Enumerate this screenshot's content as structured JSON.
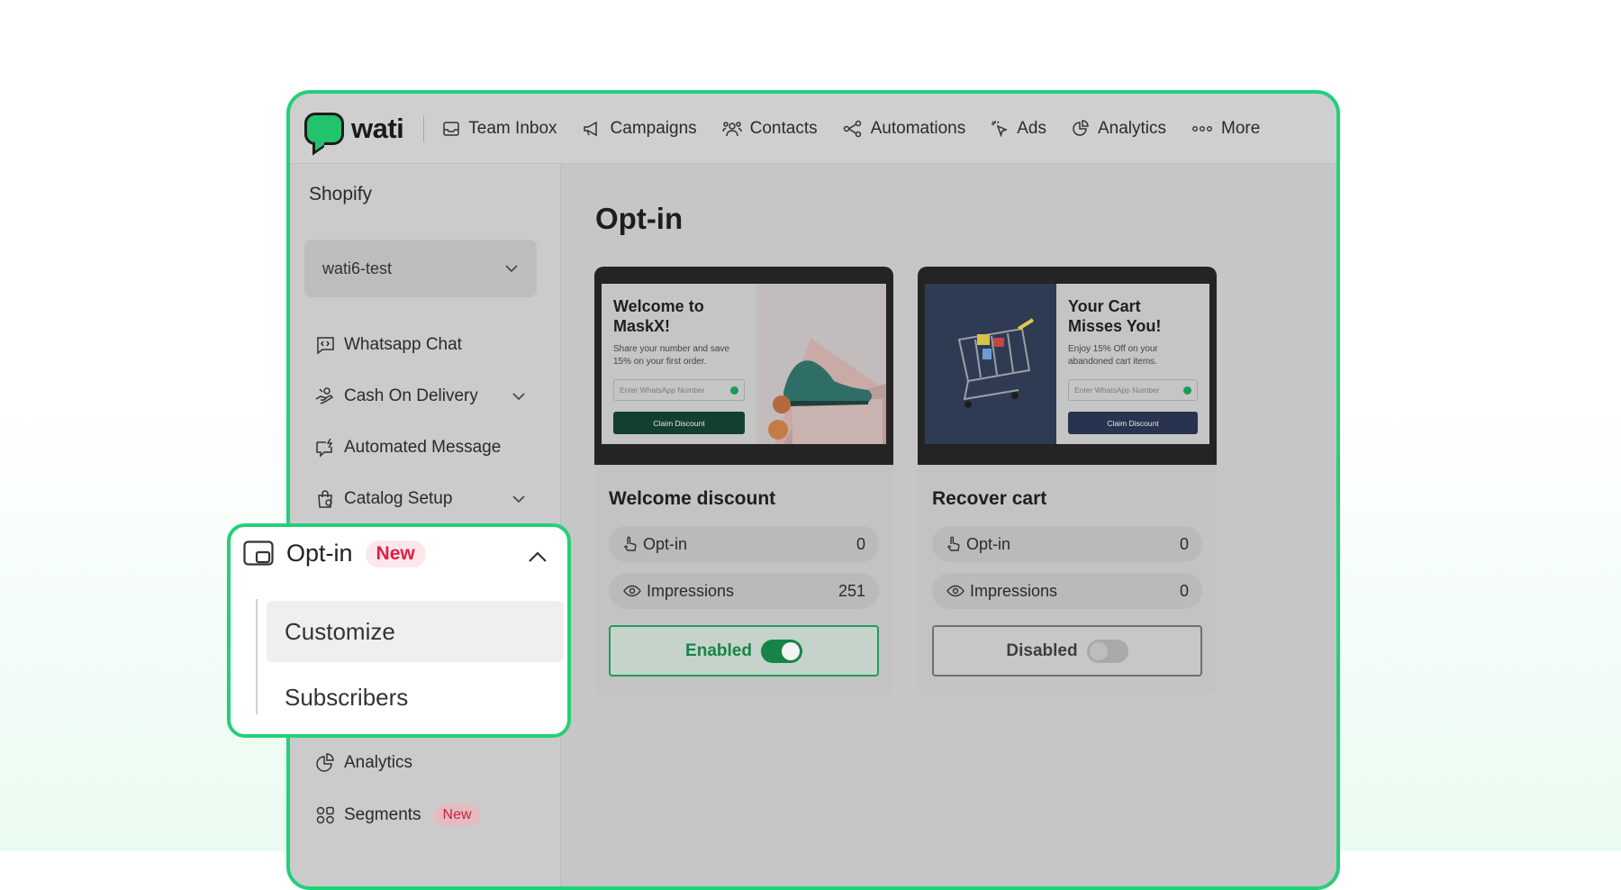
{
  "app": {
    "logo_text": "wati"
  },
  "nav": [
    {
      "label": "Team Inbox",
      "icon": "inbox-icon"
    },
    {
      "label": "Campaigns",
      "icon": "megaphone-icon"
    },
    {
      "label": "Contacts",
      "icon": "contacts-icon"
    },
    {
      "label": "Automations",
      "icon": "automation-icon"
    },
    {
      "label": "Ads",
      "icon": "cursor-click-icon"
    },
    {
      "label": "Analytics",
      "icon": "pie-chart-icon"
    },
    {
      "label": "More",
      "icon": "more-dots-icon"
    }
  ],
  "sidebar": {
    "title": "Shopify",
    "store_selector": "wati6-test",
    "items": [
      {
        "label": "Whatsapp Chat",
        "icon": "chat-code-icon"
      },
      {
        "label": "Cash On Delivery",
        "icon": "hand-money-icon"
      },
      {
        "label": "Automated Message",
        "icon": "message-bolt-icon"
      },
      {
        "label": "Catalog Setup",
        "icon": "shopping-bag-icon"
      },
      {
        "label": "Analytics",
        "icon": "pie-chart-icon"
      },
      {
        "label": "Segments",
        "icon": "segments-icon",
        "badge": "New"
      }
    ]
  },
  "optin_menu": {
    "title": "Opt-in",
    "badge": "New",
    "subitems": [
      "Customize",
      "Subscribers"
    ]
  },
  "main": {
    "title": "Opt-in",
    "cards": [
      {
        "name": "Welcome discount",
        "preview": {
          "title": "Welcome to MaskX!",
          "subtitle": "Share your number and save 15% on your first order.",
          "input_placeholder": "Enter WhatsApp Number",
          "button": "Claim Discount"
        },
        "optin_label": "Opt-in",
        "optin_value": "0",
        "impressions_label": "Impressions",
        "impressions_value": "251",
        "status": "Enabled"
      },
      {
        "name": "Recover cart",
        "preview": {
          "title": "Your Cart Misses You!",
          "subtitle": "Enjoy 15% Off on your abandoned cart items.",
          "input_placeholder": "Enter WhatsApp Number",
          "button": "Claim Discount"
        },
        "optin_label": "Opt-in",
        "optin_value": "0",
        "impressions_label": "Impressions",
        "impressions_value": "0",
        "status": "Disabled"
      }
    ]
  },
  "colors": {
    "brand_green": "#23d07a",
    "enabled_green": "#178447",
    "badge_red": "#e11d48"
  }
}
